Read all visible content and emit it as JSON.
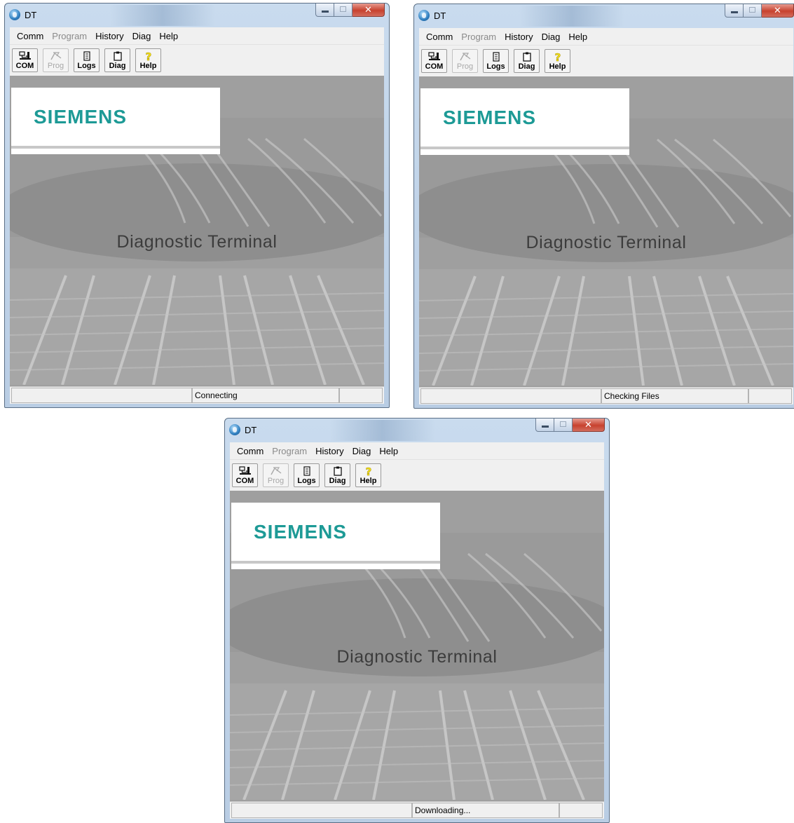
{
  "windows": [
    {
      "title": "DT",
      "menu": [
        "Comm",
        "Program",
        "History",
        "Diag",
        "Help"
      ],
      "menu_disabled": [
        "Program"
      ],
      "toolbar": [
        {
          "label": "COM",
          "icon": "com-icon",
          "enabled": true
        },
        {
          "label": "Prog",
          "icon": "prog-icon",
          "enabled": false
        },
        {
          "label": "Logs",
          "icon": "logs-icon",
          "enabled": true
        },
        {
          "label": "Diag",
          "icon": "diag-icon",
          "enabled": true
        },
        {
          "label": "Help",
          "icon": "help-icon",
          "enabled": true
        }
      ],
      "logo": "SIEMENS",
      "splash_title": "Diagnostic Terminal",
      "status": "Connecting"
    },
    {
      "title": "DT",
      "menu": [
        "Comm",
        "Program",
        "History",
        "Diag",
        "Help"
      ],
      "menu_disabled": [
        "Program"
      ],
      "toolbar": [
        {
          "label": "COM",
          "icon": "com-icon",
          "enabled": true
        },
        {
          "label": "Prog",
          "icon": "prog-icon",
          "enabled": false
        },
        {
          "label": "Logs",
          "icon": "logs-icon",
          "enabled": true
        },
        {
          "label": "Diag",
          "icon": "diag-icon",
          "enabled": true
        },
        {
          "label": "Help",
          "icon": "help-icon",
          "enabled": true
        }
      ],
      "logo": "SIEMENS",
      "splash_title": "Diagnostic Terminal",
      "status": "Checking Files"
    },
    {
      "title": "DT",
      "menu": [
        "Comm",
        "Program",
        "History",
        "Diag",
        "Help"
      ],
      "menu_disabled": [
        "Program"
      ],
      "toolbar": [
        {
          "label": "COM",
          "icon": "com-icon",
          "enabled": true
        },
        {
          "label": "Prog",
          "icon": "prog-icon",
          "enabled": false
        },
        {
          "label": "Logs",
          "icon": "logs-icon",
          "enabled": true
        },
        {
          "label": "Diag",
          "icon": "diag-icon",
          "enabled": true
        },
        {
          "label": "Help",
          "icon": "help-icon",
          "enabled": true
        }
      ],
      "logo": "SIEMENS",
      "splash_title": "Diagnostic Terminal",
      "status": "Downloading..."
    }
  ],
  "colors": {
    "logo_teal": "#1d9a96",
    "splash_gray": "#9f9f9f",
    "help_yellow": "#f2e21c",
    "close_red": "#c7422f"
  }
}
